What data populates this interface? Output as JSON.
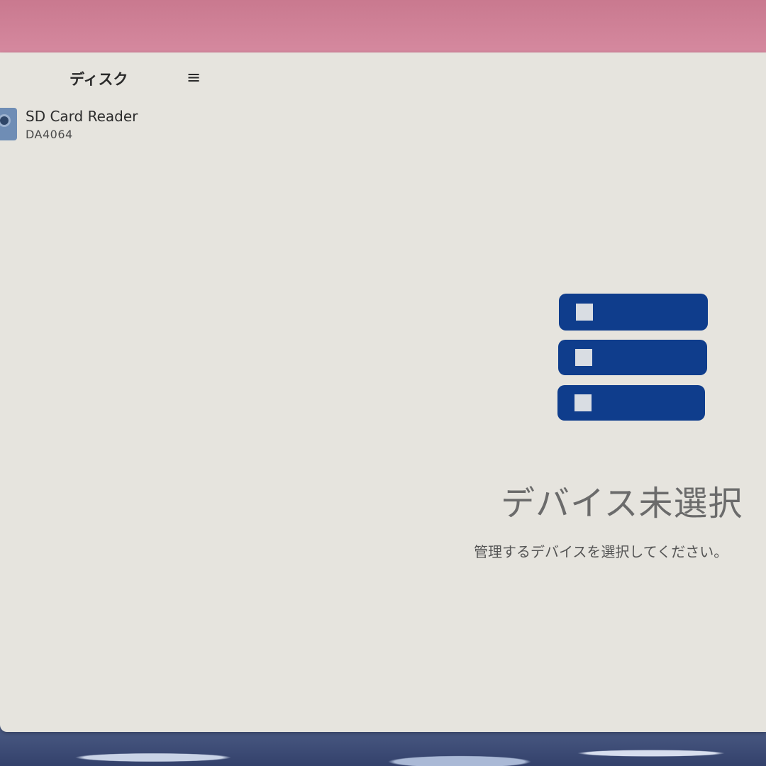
{
  "sidebar": {
    "title": "ディスク",
    "menu_icon": "hamburger-menu-icon",
    "menu_glyph": "≡",
    "items": [
      {
        "name": "SD Card Reader",
        "subtitle": "DA4064",
        "icon": "disk-drive-icon"
      }
    ]
  },
  "main": {
    "empty_state": {
      "icon": "storage-stack-icon",
      "title": "デバイス未選択",
      "subtitle": "管理するデバイスを選択してください。"
    }
  },
  "colors": {
    "accent": "#0f3d8c",
    "window_bg": "#e6e4de",
    "desktop_top": "#d08499"
  }
}
